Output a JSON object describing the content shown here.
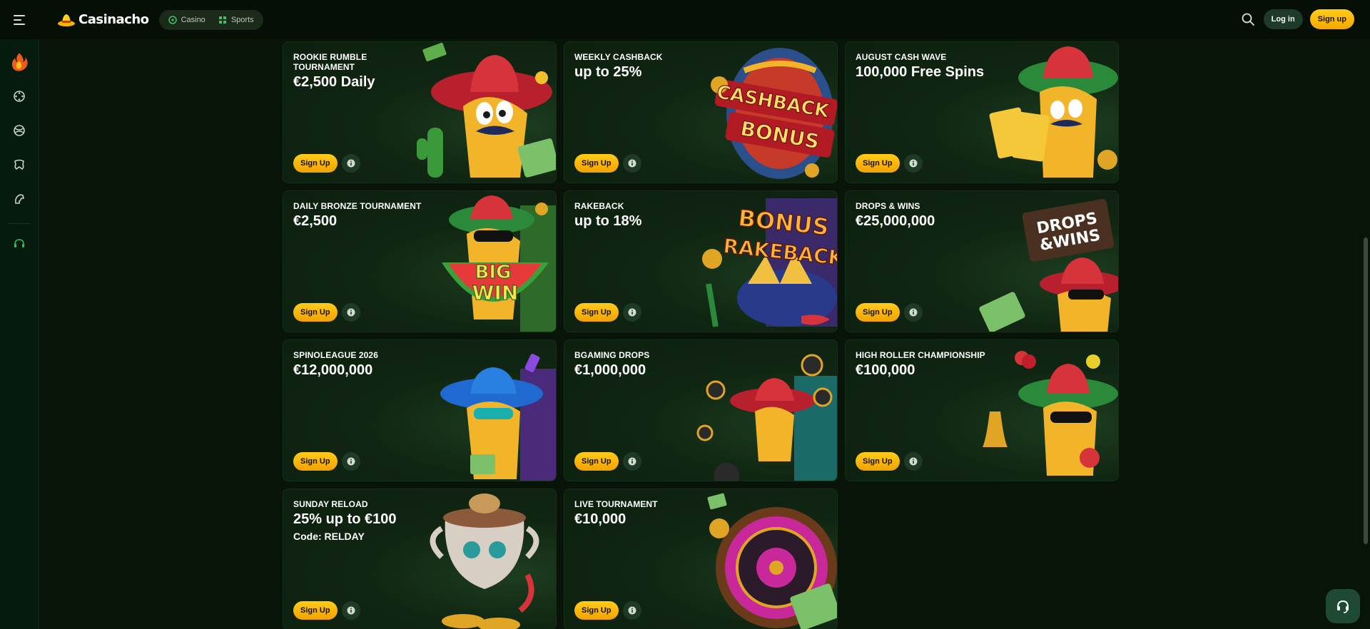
{
  "header": {
    "brand": "Casinacho",
    "nav": [
      {
        "label": "Casino",
        "icon": "casino-icon"
      },
      {
        "label": "Sports",
        "icon": "sports-icon"
      }
    ],
    "login_label": "Log in",
    "signup_label": "Sign up"
  },
  "sidebar": {
    "items": [
      {
        "icon": "fire-icon"
      },
      {
        "icon": "dice-icon"
      },
      {
        "icon": "sports-ball-icon"
      },
      {
        "icon": "game-icon"
      },
      {
        "icon": "horse-icon"
      },
      {
        "icon": "support-icon"
      }
    ]
  },
  "promotions": [
    {
      "title": "ROOKIE RUMBLE TOURNAMENT",
      "value": "€2,500 Daily",
      "code": "",
      "art_text": "",
      "signup": "Sign Up"
    },
    {
      "title": "WEEKLY CASHBACK",
      "value": "up to 25%",
      "code": "",
      "art_text": "CASHBACK BONUS",
      "signup": "Sign Up"
    },
    {
      "title": "AUGUST CASH WAVE",
      "value": "100,000 Free Spins",
      "code": "",
      "art_text": "",
      "signup": "Sign Up"
    },
    {
      "title": "DAILY BRONZE TOURNAMENT",
      "value": "€2,500",
      "code": "",
      "art_text": "BIG WIN",
      "signup": "Sign Up"
    },
    {
      "title": "RAKEBACK",
      "value": "up to 18%",
      "code": "",
      "art_text": "BONUS RAKEBACK",
      "signup": "Sign Up"
    },
    {
      "title": "DROPS & WINS",
      "value": "€25,000,000",
      "code": "",
      "art_text": "DROPS & WINS",
      "signup": "Sign Up"
    },
    {
      "title": "SPINOLEAGUE 2026",
      "value": "€12,000,000",
      "code": "",
      "art_text": "",
      "signup": "Sign Up"
    },
    {
      "title": "BGAMING DROPS",
      "value": "€1,000,000",
      "code": "",
      "art_text": "",
      "signup": "Sign Up"
    },
    {
      "title": "HIGH ROLLER CHAMPIONSHIP",
      "value": "€100,000",
      "code": "",
      "art_text": "",
      "signup": "Sign Up"
    },
    {
      "title": "SUNDAY RELOAD",
      "value": "25% up to €100",
      "code": "Code: RELDAY",
      "art_text": "",
      "signup": "Sign Up"
    },
    {
      "title": "LIVE TOURNAMENT",
      "value": "€10,000",
      "code": "",
      "art_text": "",
      "signup": "Sign Up"
    }
  ],
  "colors": {
    "accent": "#ffc107",
    "background": "#071407",
    "card": "#102612"
  }
}
